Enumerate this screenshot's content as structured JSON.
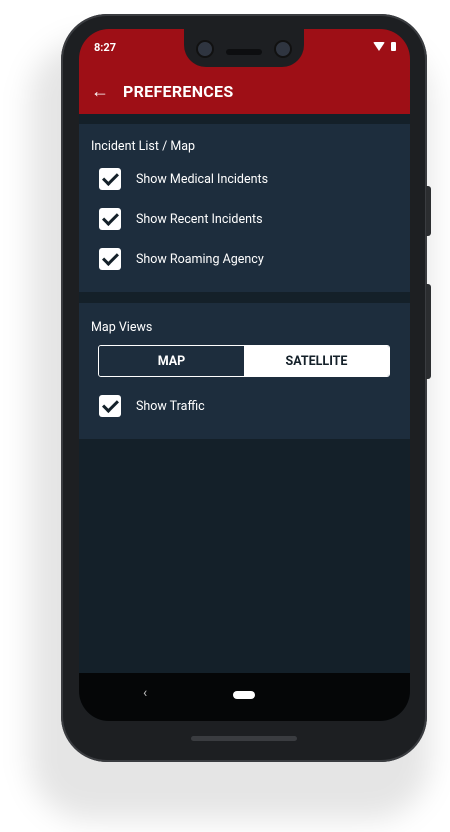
{
  "status_bar": {
    "time": "8:27",
    "icons": [
      "wifi-icon",
      "battery-icon"
    ]
  },
  "app_bar": {
    "back_icon": "arrow-left-icon",
    "title": "PREFERENCES",
    "color": "#9e0f16"
  },
  "sections": [
    {
      "title": "Incident List / Map",
      "options": [
        {
          "label": "Show Medical Incidents",
          "checked": true
        },
        {
          "label": "Show Recent Incidents",
          "checked": true
        },
        {
          "label": "Show Roaming Agency",
          "checked": true
        }
      ]
    },
    {
      "title": "Map Views",
      "segmented": {
        "options": [
          "MAP",
          "SATELLITE"
        ],
        "selected": "MAP"
      },
      "options": [
        {
          "label": "Show Traffic",
          "checked": true
        }
      ]
    }
  ],
  "nav_bar": {
    "back_symbol": "‹",
    "icons": [
      "back-icon",
      "home-pill-icon"
    ]
  },
  "colors": {
    "background": "#142029",
    "card": "#1d2d3d",
    "accent": "#9e0f16"
  }
}
